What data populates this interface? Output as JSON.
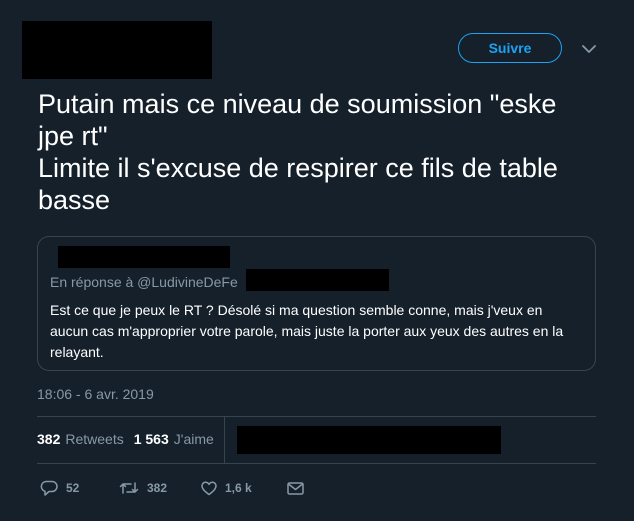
{
  "header": {
    "follow_label": "Suivre"
  },
  "tweet": {
    "text_lines": [
      "Putain mais ce niveau de soumission \"eske jpe rt\"",
      "Limite il s'excuse de respirer ce fils de table basse"
    ]
  },
  "quote": {
    "reply_prefix": "En réponse à @LudivineDeFe",
    "text": "Est ce que je peux le RT ? Désolé si ma question semble conne, mais j'veux en aucun cas m'approprier votre parole, mais juste la porter aux yeux des autres en la relayant."
  },
  "meta": {
    "timestamp": "18:06 - 6 avr. 2019"
  },
  "stats": {
    "retweets_count": "382",
    "retweets_label": "Retweets",
    "likes_count": "1 563",
    "likes_label": "J'aime"
  },
  "actions": {
    "reply_count": "52",
    "retweet_count": "382",
    "like_count": "1,6 k"
  },
  "icons": {
    "reply": "reply-icon",
    "retweet": "retweet-icon",
    "like": "heart-icon",
    "dm": "envelope-icon",
    "caret": "chevron-down-icon"
  },
  "colors": {
    "background": "#15202b",
    "accent": "#1da1f2",
    "muted": "#8899a6",
    "border": "#38444d"
  }
}
